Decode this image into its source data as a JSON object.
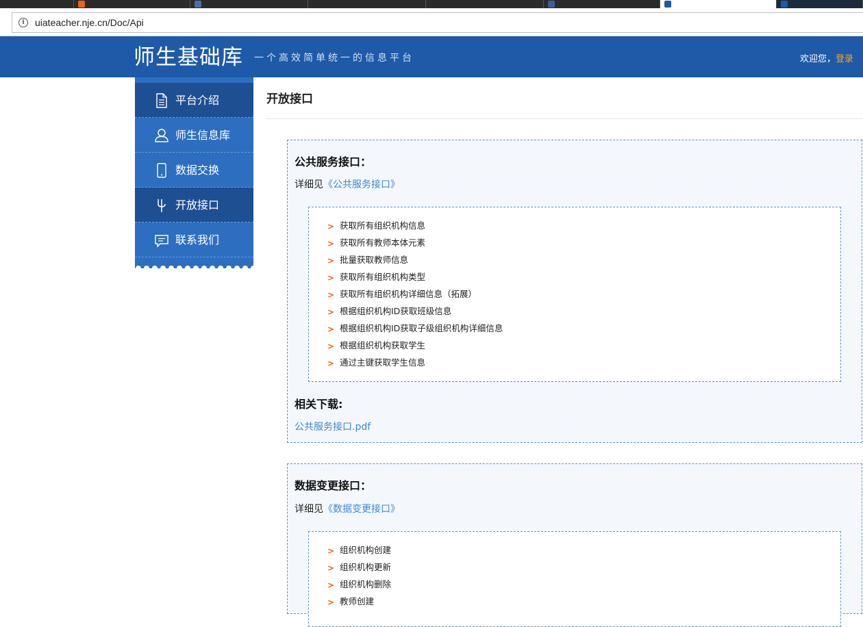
{
  "browser": {
    "url": "uiateacher.nje.cn/Doc/Api"
  },
  "header": {
    "brand": "师生基础库",
    "slogan": "一个高效简单统一的信息平台",
    "welcome": "欢迎您，",
    "login_label": "登录"
  },
  "sidebar": {
    "items": [
      {
        "label": "平台介绍",
        "icon": "document-icon"
      },
      {
        "label": "师生信息库",
        "icon": "user-icon"
      },
      {
        "label": "数据交换",
        "icon": "phone-icon"
      },
      {
        "label": "开放接口",
        "icon": "plug-icon",
        "active": true
      },
      {
        "label": "联系我们",
        "icon": "message-icon"
      }
    ]
  },
  "main": {
    "title": "开放接口",
    "sections": [
      {
        "title": "公共服务接口：",
        "detail_prefix": "详细见",
        "detail_link": "《公共服务接口》",
        "items": [
          "获取所有组织机构信息",
          "获取所有教师本体元素",
          "批量获取教师信息",
          "获取所有组织机构类型",
          "获取所有组织机构详细信息（拓展）",
          "根据组织机构ID获取班级信息",
          "根据组织机构ID获取子级组织机构详细信息",
          "根据组织机构获取学生",
          "通过主键获取学生信息"
        ],
        "download_title": "相关下载:",
        "download_link": "公共服务接口.pdf"
      },
      {
        "title": "数据变更接口：",
        "detail_prefix": "详细见",
        "detail_link": "《数据变更接口》",
        "items": [
          "组织机构创建",
          "组织机构更新",
          "组织机构删除",
          "教师创建"
        ]
      }
    ]
  }
}
